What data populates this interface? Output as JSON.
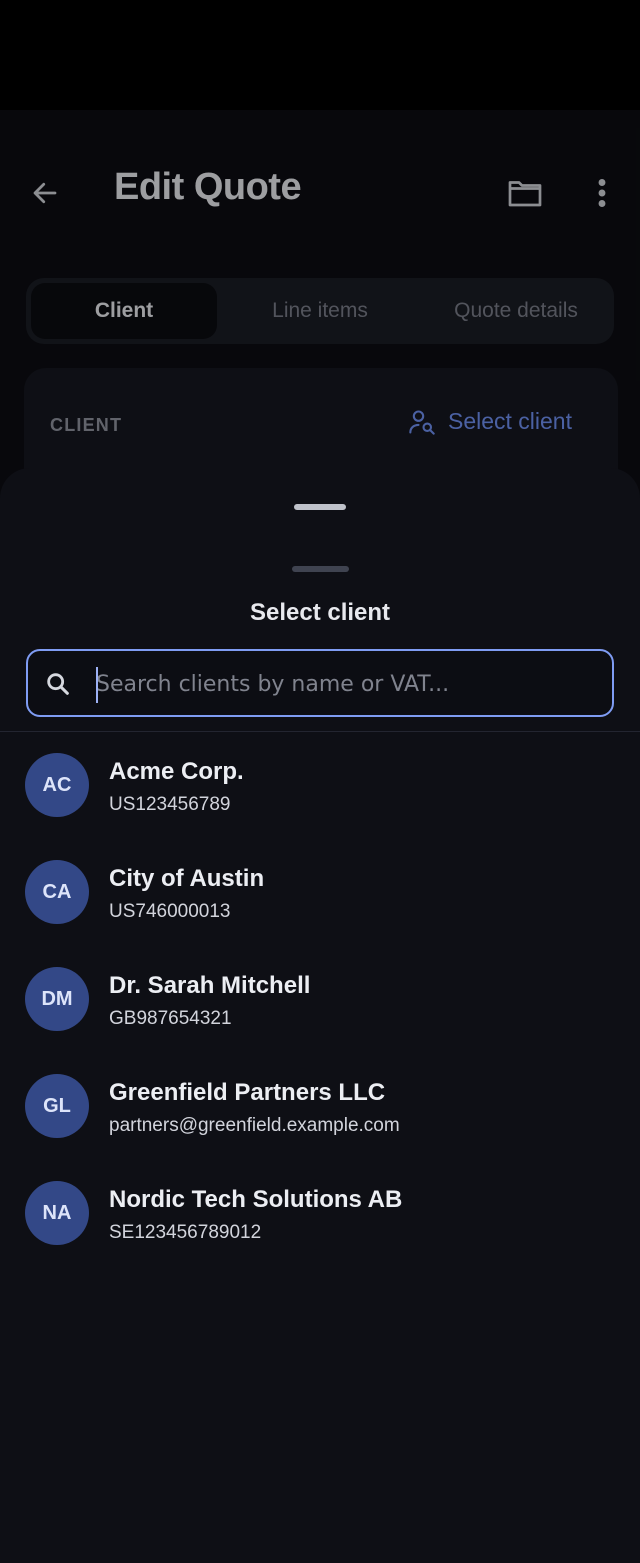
{
  "header": {
    "title": "Edit Quote",
    "back_icon": "arrow-left-icon",
    "folder_icon": "folder-icon",
    "more_icon": "more-vertical-icon"
  },
  "tabs": [
    {
      "label": "Client",
      "active": true
    },
    {
      "label": "Line items",
      "active": false
    },
    {
      "label": "Quote details",
      "active": false
    }
  ],
  "client_section": {
    "label": "CLIENT",
    "select_label": "Select client",
    "select_icon": "user-search-icon"
  },
  "sheet": {
    "title": "Select client",
    "search_placeholder": "Search clients by name or VAT...",
    "search_value": "",
    "search_icon": "search-icon"
  },
  "clients": [
    {
      "initials": "AC",
      "name": "Acme Corp.",
      "sub": "US123456789"
    },
    {
      "initials": "CA",
      "name": "City of Austin",
      "sub": "US746000013"
    },
    {
      "initials": "DM",
      "name": "Dr. Sarah Mitchell",
      "sub": "GB987654321"
    },
    {
      "initials": "GL",
      "name": "Greenfield Partners LLC",
      "sub": "partners@greenfield.example.com"
    },
    {
      "initials": "NA",
      "name": "Nordic Tech Solutions AB",
      "sub": "SE123456789012"
    }
  ],
  "colors": {
    "accent": "#7f9cf3",
    "avatar_bg": "#334887",
    "sheet_bg": "#0e0f15"
  }
}
